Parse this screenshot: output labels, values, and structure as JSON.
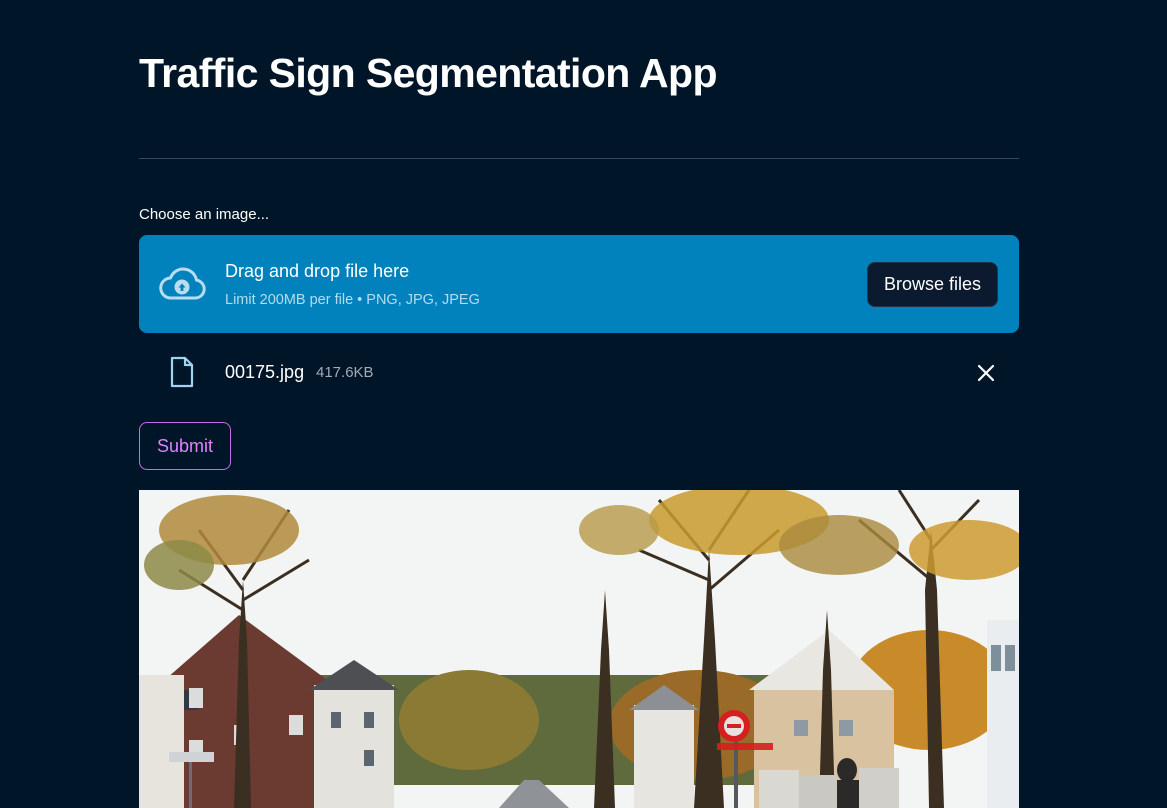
{
  "page": {
    "title": "Traffic Sign Segmentation App"
  },
  "uploader": {
    "label": "Choose an image...",
    "dropzone_title": "Drag and drop file here",
    "dropzone_limit": "Limit 200MB per file • PNG, JPG, JPEG",
    "browse_label": "Browse files"
  },
  "uploaded_file": {
    "name": "00175.jpg",
    "size": "417.6KB"
  },
  "form": {
    "submit_label": "Submit"
  },
  "colors": {
    "background": "#011529",
    "dropzone": "#0282bc",
    "submit_accent": "#df82ff",
    "sign_red": "#d61f1f"
  },
  "icons": {
    "upload": "cloud-upload-icon",
    "file": "file-icon",
    "remove": "close-icon"
  }
}
